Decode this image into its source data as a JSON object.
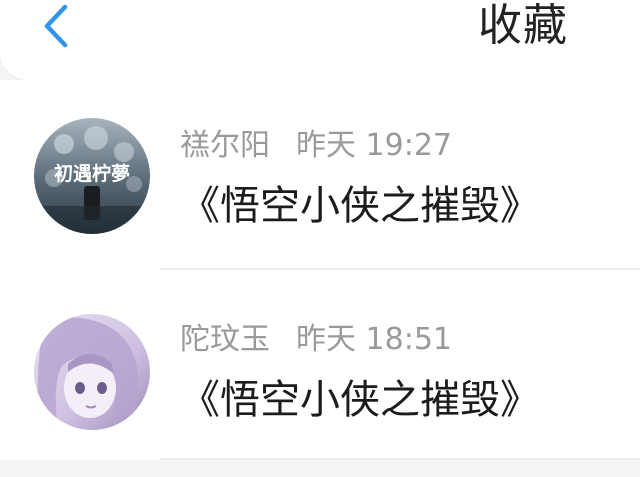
{
  "header": {
    "title": "收藏",
    "back_icon": "chevron-left-icon"
  },
  "items": [
    {
      "name": "禚尔阳",
      "time": "昨天 19:27",
      "content": "《悟空小侠之摧毁》",
      "avatar_text": "初遇柠夢"
    },
    {
      "name": "陀玟玉",
      "time": "昨天 18:51",
      "content": "《悟空小侠之摧毁》"
    }
  ],
  "colors": {
    "accent": "#2f95ee",
    "background": "#f4f4f6",
    "meta_text": "#9a9a9a"
  }
}
